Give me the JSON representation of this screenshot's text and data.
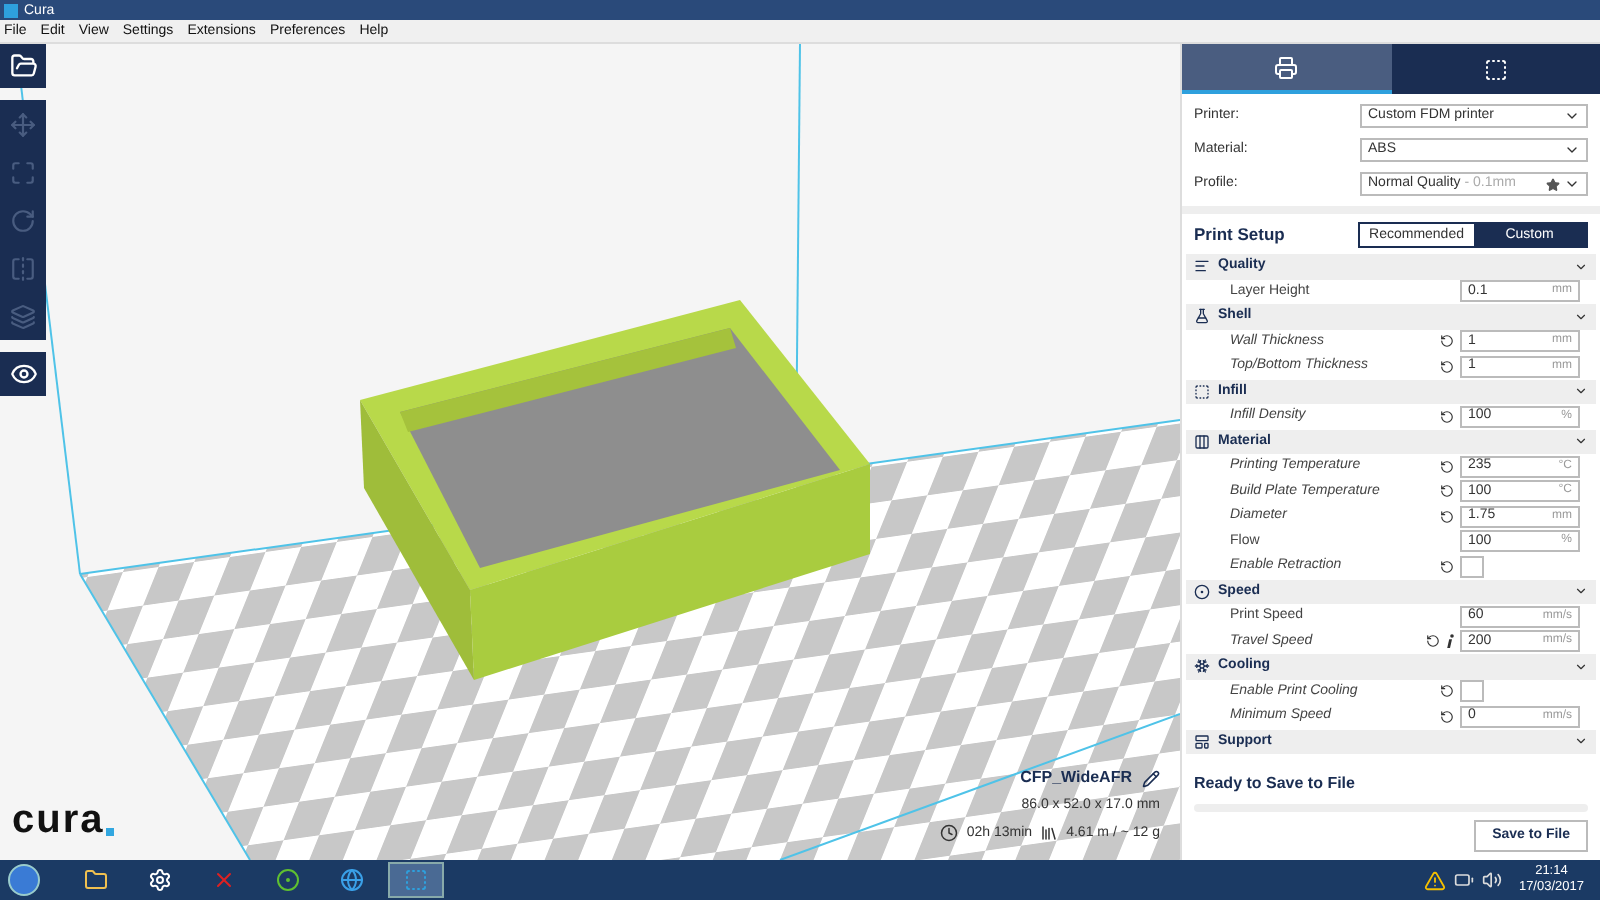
{
  "window": {
    "title": "Cura"
  },
  "menu": [
    "File",
    "Edit",
    "View",
    "Settings",
    "Extensions",
    "Preferences",
    "Help"
  ],
  "toolbar": {
    "tools": [
      {
        "disabled": true
      },
      {
        "disabled": true
      },
      {
        "disabled": true
      },
      {
        "disabled": true
      },
      {
        "disabled": true
      }
    ]
  },
  "viewport": {
    "logo": "cura",
    "job_name": "CFP_WideAFR",
    "dimensions": "86.0 x 52.0 x 17.0 mm",
    "print_time": "02h 13min",
    "material_usage": "4.61 m / ~ 12 g"
  },
  "sidebar": {
    "mode_tabs": [
      {
        "selected": true
      },
      {
        "selected": false
      }
    ],
    "machine": [
      {
        "label": "Printer:",
        "value": "Custom FDM printer"
      },
      {
        "label": "Material:",
        "value": "ABS"
      },
      {
        "label": "Profile:",
        "value": "Normal Quality",
        "detail": " - 0.1mm"
      }
    ],
    "print_setup": {
      "title": "Print Setup",
      "modes": [
        {
          "label": "Recommended",
          "selected": false
        },
        {
          "label": "Custom",
          "selected": true
        }
      ]
    },
    "categories": [
      {
        "title": "Quality",
        "settings": [
          {
            "kind": "field",
            "label": "Layer Height",
            "modified": false,
            "info": false,
            "value": "0.1",
            "unit": "mm"
          }
        ]
      },
      {
        "title": "Shell",
        "settings": [
          {
            "kind": "field",
            "label": "Wall Thickness",
            "modified": true,
            "info": false,
            "value": "1",
            "unit": "mm"
          },
          {
            "kind": "field",
            "label": "Top/Bottom Thickness",
            "modified": true,
            "info": false,
            "value": "1",
            "unit": "mm"
          }
        ]
      },
      {
        "title": "Infill",
        "settings": [
          {
            "kind": "field",
            "label": "Infill Density",
            "modified": true,
            "info": false,
            "value": "100",
            "unit": "%"
          }
        ]
      },
      {
        "title": "Material",
        "settings": [
          {
            "kind": "field",
            "label": "Printing Temperature",
            "modified": true,
            "info": false,
            "value": "235",
            "unit": "°C"
          },
          {
            "kind": "field",
            "label": "Build Plate Temperature",
            "modified": true,
            "info": false,
            "value": "100",
            "unit": "°C"
          },
          {
            "kind": "field",
            "label": "Diameter",
            "modified": true,
            "info": false,
            "value": "1.75",
            "unit": "mm"
          },
          {
            "kind": "field",
            "label": "Flow",
            "modified": false,
            "info": false,
            "value": "100",
            "unit": "%"
          },
          {
            "kind": "checkbox",
            "label": "Enable Retraction",
            "modified": true,
            "info": false,
            "checked": false
          }
        ]
      },
      {
        "title": "Speed",
        "settings": [
          {
            "kind": "field",
            "label": "Print Speed",
            "modified": false,
            "info": false,
            "value": "60",
            "unit": "mm/s"
          },
          {
            "kind": "field",
            "label": "Travel Speed",
            "modified": true,
            "info": true,
            "value": "200",
            "unit": "mm/s"
          }
        ]
      },
      {
        "title": "Cooling",
        "settings": [
          {
            "kind": "checkbox",
            "label": "Enable Print Cooling",
            "modified": true,
            "info": false,
            "checked": false
          },
          {
            "kind": "field",
            "label": "Minimum Speed",
            "modified": true,
            "info": false,
            "value": "0",
            "unit": "mm/s"
          }
        ]
      },
      {
        "title": "Support"
      }
    ],
    "status": "Ready to Save to File",
    "progress": {
      "level": 0
    },
    "save_button": "Save to File"
  },
  "taskbar": {
    "apps": [
      {
        "selected": false
      },
      {
        "selected": false
      },
      {
        "selected": false
      },
      {
        "selected": false
      },
      {
        "selected": false
      },
      {
        "selected": true
      }
    ],
    "time": "21:14",
    "date": "17/03/2017"
  }
}
